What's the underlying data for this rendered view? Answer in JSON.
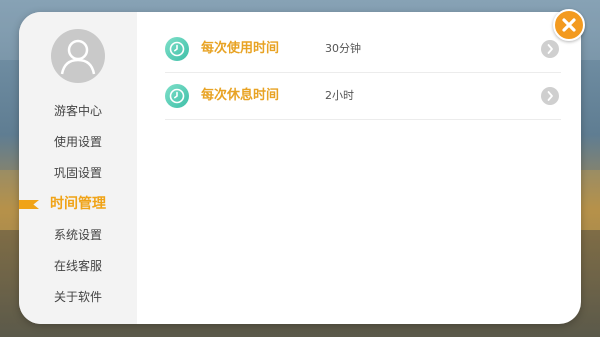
{
  "sidebar": {
    "items": [
      {
        "label": "游客中心"
      },
      {
        "label": "使用设置"
      },
      {
        "label": "巩固设置"
      },
      {
        "label": "时间管理"
      },
      {
        "label": "系统设置"
      },
      {
        "label": "在线客服"
      },
      {
        "label": "关于软件"
      }
    ],
    "active_index": 3
  },
  "settings": [
    {
      "label": "每次使用时间",
      "value": "30分钟",
      "icon": "clock-icon"
    },
    {
      "label": "每次休息时间",
      "value": "2小时",
      "icon": "clock-icon"
    }
  ],
  "colors": {
    "accent": "#f0a317",
    "label": "#e8a324",
    "icon": "#3fbfa8",
    "close": "#f39a1f"
  }
}
